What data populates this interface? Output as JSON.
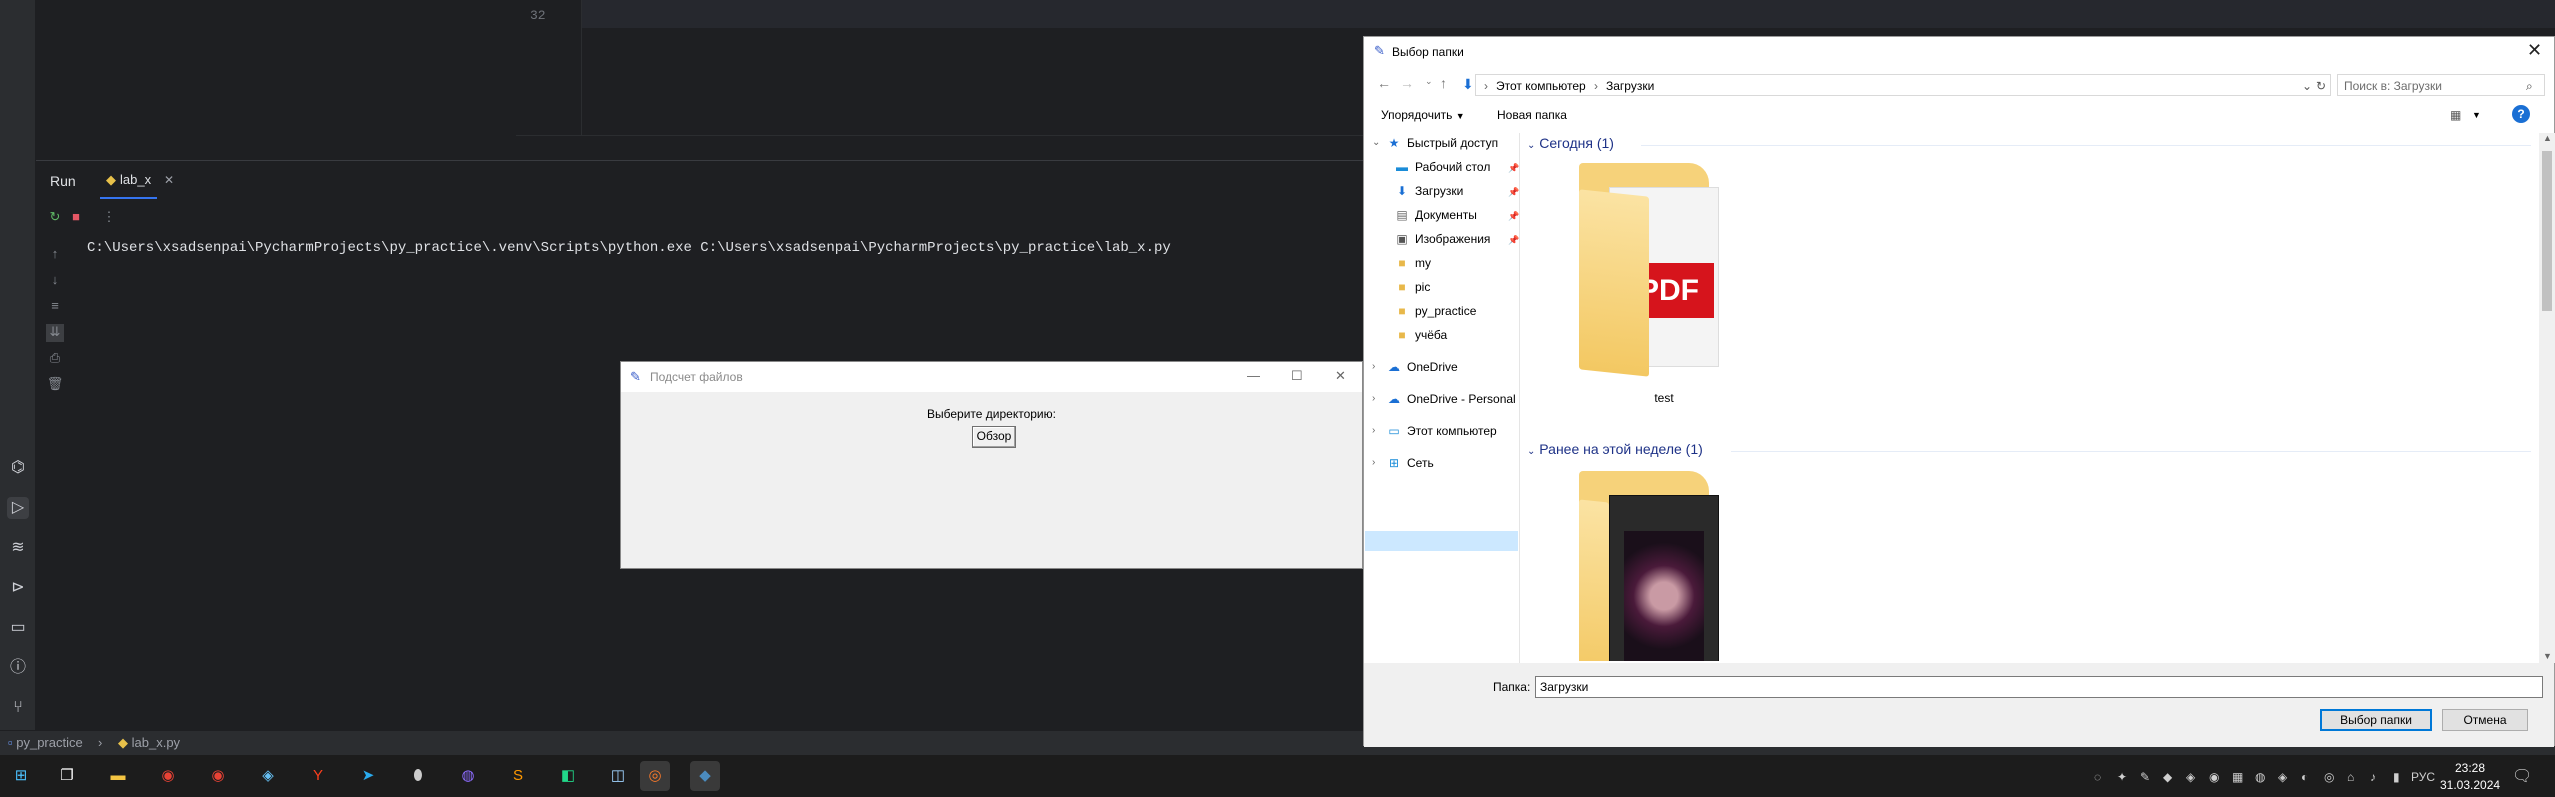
{
  "ide": {
    "line_number": "32",
    "run_tab": "Run",
    "file_tab": "lab_x",
    "console_command": "C:\\Users\\xsadsenpai\\PycharmProjects\\py_practice\\.venv\\Scripts\\python.exe C:\\Users\\xsadsenpai\\PycharmProjects\\py_practice\\lab_x.py",
    "breadcrumb_project": "py_practice",
    "breadcrumb_file": "lab_x.py"
  },
  "tk_window": {
    "title": "Подсчет файлов",
    "prompt": "Выберите директорию:",
    "browse_button": "Обзор"
  },
  "dialog": {
    "title": "Выбор папки",
    "address": [
      "Этот компьютер",
      "Загрузки"
    ],
    "search_placeholder": "Поиск в: Загрузки",
    "organize": "Упорядочить",
    "new_folder": "Новая папка",
    "nav": {
      "quick_access": "Быстрый доступ",
      "desktop": "Рабочий стол",
      "downloads": "Загрузки",
      "documents": "Документы",
      "pictures": "Изображения",
      "my": "my",
      "pic": "pic",
      "py_practice": "py_practice",
      "study": "учёба",
      "onedrive": "OneDrive",
      "onedrive_personal": "OneDrive - Personal",
      "this_pc": "Этот компьютер",
      "network": "Сеть"
    },
    "groups": {
      "today": "Сегодня (1)",
      "earlier": "Ранее на этой неделе (1)"
    },
    "folders": {
      "test": "test"
    },
    "folder_label": "Папка:",
    "folder_value": "Загрузки",
    "select_button": "Выбор папки",
    "cancel_button": "Отмена"
  },
  "taskbar": {
    "lang": "РУС",
    "time": "23:28",
    "date": "31.03.2024"
  },
  "colors": {
    "accent": "#3574f0",
    "ide_bg": "#1e1f22",
    "dialog_selection": "#cce8ff"
  }
}
